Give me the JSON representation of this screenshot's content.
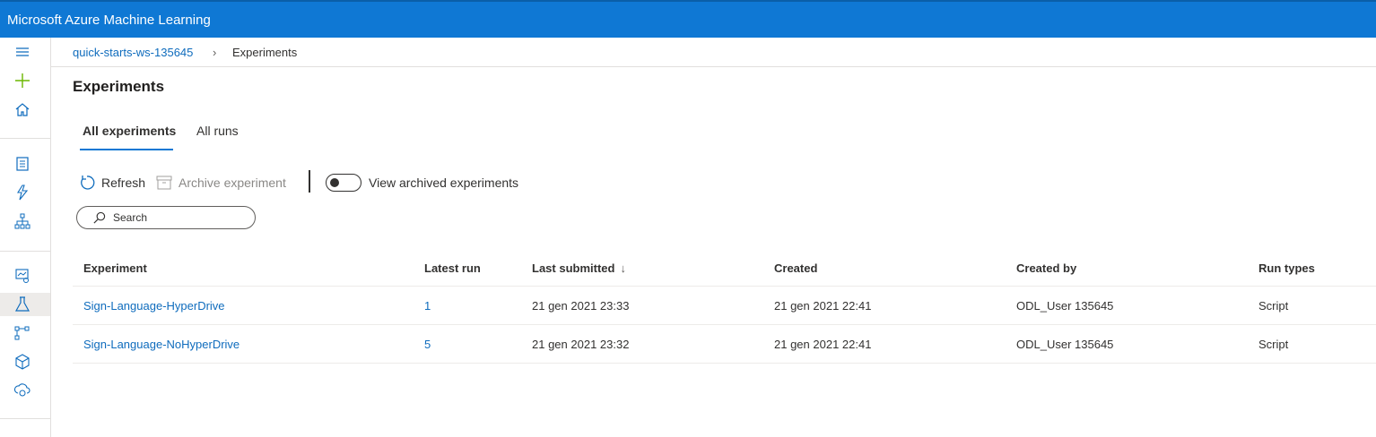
{
  "app": {
    "title": "Microsoft Azure Machine Learning"
  },
  "breadcrumb": {
    "workspace": "quick-starts-ws-135645",
    "separator": "›",
    "current": "Experiments"
  },
  "page": {
    "title": "Experiments"
  },
  "tabs": [
    {
      "label": "All experiments",
      "selected": true
    },
    {
      "label": "All runs",
      "selected": false
    }
  ],
  "toolbar": {
    "refresh_label": "Refresh",
    "archive_label": "Archive experiment",
    "toggle_label": "View archived experiments",
    "toggle_on": false
  },
  "search": {
    "placeholder": "Search"
  },
  "table": {
    "columns": [
      "Experiment",
      "Latest run",
      "Last submitted",
      "Created",
      "Created by",
      "Run types"
    ],
    "sort_indicator": "↓",
    "rows": [
      [
        "Sign-Language-HyperDrive",
        "1",
        "21 gen 2021 23:33",
        "21 gen 2021 22:41",
        "ODL_User 135645",
        "Script"
      ],
      [
        "Sign-Language-NoHyperDrive",
        "5",
        "21 gen 2021 23:32",
        "21 gen 2021 22:41",
        "ODL_User 135645",
        "Script"
      ]
    ]
  },
  "colors": {
    "brand": "#0f78d4",
    "link": "#0f6cbd",
    "add_icon": "#6bb700"
  },
  "rail_icons": [
    "hamburger-icon",
    "add-icon",
    "home-icon",
    "notebook-icon",
    "automl-icon",
    "designer-icon",
    "datasets-icon",
    "experiments-icon",
    "pipelines-icon",
    "models-icon",
    "endpoints-icon"
  ]
}
